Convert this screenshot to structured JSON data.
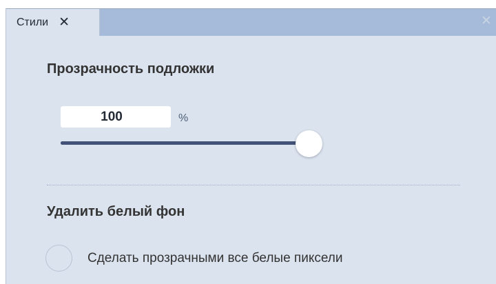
{
  "tabs": [
    {
      "label": "Стили",
      "close_glyph": "✕",
      "active": true
    }
  ],
  "panel": {
    "close_glyph": "✕"
  },
  "transparency": {
    "heading": "Прозрачность подложки",
    "value": "100",
    "unit": "%",
    "slider_level_percent": 100
  },
  "white_bg": {
    "heading": "Удалить белый фон",
    "option_label": "Сделать прозрачными все белые пиксели",
    "option_checked": false
  },
  "colors": {
    "tab_strip": "#a5bbd9",
    "panel_bg": "#dbe3ee",
    "slider": "#425177"
  },
  "icons": {
    "tab_close": "close-icon",
    "panel_close": "close-icon"
  }
}
